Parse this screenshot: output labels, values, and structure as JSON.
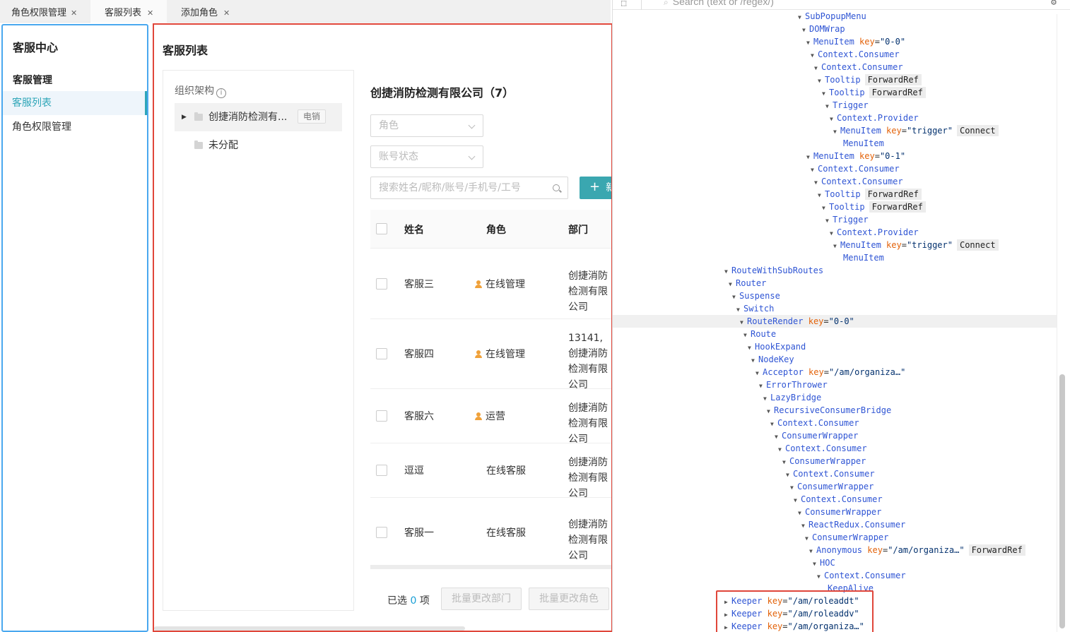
{
  "tabs": [
    {
      "label": "角色权限管理",
      "active": false
    },
    {
      "label": "客服列表",
      "active": true
    },
    {
      "label": "添加角色",
      "active": false
    }
  ],
  "sidebar": {
    "title": "客服中心",
    "section": "客服管理",
    "items": [
      {
        "label": "客服列表",
        "active": true
      },
      {
        "label": "角色权限管理",
        "active": false
      }
    ]
  },
  "main": {
    "title": "客服列表",
    "org": {
      "header": "组织架构",
      "nodes": [
        {
          "label": "创捷消防检测有...",
          "tag": "电销"
        },
        {
          "label": "未分配"
        }
      ]
    },
    "company": "创捷消防检测有限公司（7）",
    "filters": {
      "role_placeholder": "角色",
      "status_placeholder": "账号状态"
    },
    "search_placeholder": "搜索姓名/昵称/账号/手机号/工号",
    "add_label": "新",
    "table": {
      "columns": [
        "姓名",
        "角色",
        "部门"
      ],
      "rows": [
        {
          "name": "客服三",
          "role": "在线管理",
          "dept": "创捷消防检测有限公司",
          "admin": true
        },
        {
          "name": "客服四",
          "role": "在线管理",
          "dept": "13141,创捷消防检测有限公司",
          "admin": true
        },
        {
          "name": "客服六",
          "role": "运营",
          "dept": "创捷消防检测有限公司",
          "admin": true
        },
        {
          "name": "逗逗",
          "role": "在线客服",
          "dept": "创捷消防检测有限公司",
          "admin": false
        },
        {
          "name": "客服一",
          "role": "在线客服",
          "dept": "创捷消防检测有限公司",
          "admin": false
        }
      ]
    },
    "footer": {
      "selected_prefix": "已选",
      "selected_count": "0",
      "selected_suffix": "项",
      "btn_dept": "批量更改部门",
      "btn_role": "批量更改角色"
    }
  },
  "devtools": {
    "search_placeholder": "Search (text or /regex/)",
    "tree": [
      {
        "indent": 262,
        "name": "SubPopupMenu"
      },
      {
        "indent": 268,
        "name": "DOMWrap"
      },
      {
        "indent": 274,
        "name": "MenuItem",
        "key": "0-0"
      },
      {
        "indent": 280,
        "name": "Context.Consumer"
      },
      {
        "indent": 285,
        "name": "Context.Consumer"
      },
      {
        "indent": 290,
        "name": "Tooltip",
        "badge": "ForwardRef"
      },
      {
        "indent": 296,
        "name": "Tooltip",
        "badge": "ForwardRef"
      },
      {
        "indent": 301,
        "name": "Trigger"
      },
      {
        "indent": 307,
        "name": "Context.Provider"
      },
      {
        "indent": 312,
        "name": "MenuItem",
        "key": "trigger",
        "badge": "Connect"
      },
      {
        "indent": 326,
        "name": "MenuItem",
        "leaf": true
      },
      {
        "indent": 274,
        "name": "MenuItem",
        "key": "0-1"
      },
      {
        "indent": 280,
        "name": "Context.Consumer"
      },
      {
        "indent": 285,
        "name": "Context.Consumer"
      },
      {
        "indent": 290,
        "name": "Tooltip",
        "badge": "ForwardRef"
      },
      {
        "indent": 296,
        "name": "Tooltip",
        "badge": "ForwardRef"
      },
      {
        "indent": 301,
        "name": "Trigger"
      },
      {
        "indent": 307,
        "name": "Context.Provider"
      },
      {
        "indent": 312,
        "name": "MenuItem",
        "key": "trigger",
        "badge": "Connect"
      },
      {
        "indent": 326,
        "name": "MenuItem",
        "leaf": true
      },
      {
        "indent": 158,
        "name": "RouteWithSubRoutes"
      },
      {
        "indent": 164,
        "name": "Router"
      },
      {
        "indent": 169,
        "name": "Suspense"
      },
      {
        "indent": 175,
        "name": "Switch"
      },
      {
        "indent": 180,
        "name": "RouteRender",
        "key": "0-0",
        "hl": true
      },
      {
        "indent": 185,
        "name": "Route"
      },
      {
        "indent": 191,
        "name": "HookExpand"
      },
      {
        "indent": 196,
        "name": "NodeKey"
      },
      {
        "indent": 202,
        "name": "Acceptor",
        "key": "/am/organiza…"
      },
      {
        "indent": 207,
        "name": "ErrorThrower"
      },
      {
        "indent": 213,
        "name": "LazyBridge"
      },
      {
        "indent": 218,
        "name": "RecursiveConsumerBridge"
      },
      {
        "indent": 223,
        "name": "Context.Consumer"
      },
      {
        "indent": 229,
        "name": "ConsumerWrapper"
      },
      {
        "indent": 234,
        "name": "Context.Consumer"
      },
      {
        "indent": 240,
        "name": "ConsumerWrapper"
      },
      {
        "indent": 245,
        "name": "Context.Consumer"
      },
      {
        "indent": 251,
        "name": "ConsumerWrapper"
      },
      {
        "indent": 256,
        "name": "Context.Consumer"
      },
      {
        "indent": 262,
        "name": "ConsumerWrapper"
      },
      {
        "indent": 267,
        "name": "ReactRedux.Consumer"
      },
      {
        "indent": 272,
        "name": "ConsumerWrapper"
      },
      {
        "indent": 278,
        "name": "Anonymous",
        "key": "/am/organiza…",
        "badge": "ForwardRef"
      },
      {
        "indent": 283,
        "name": "HOC"
      },
      {
        "indent": 289,
        "name": "Context.Consumer"
      },
      {
        "indent": 304,
        "name": "KeepAlive",
        "leaf": true
      },
      {
        "indent": 158,
        "name": "Keeper",
        "key": "/am/roleaddt",
        "collapsed": true
      },
      {
        "indent": 158,
        "name": "Keeper",
        "key": "/am/roleaddv",
        "collapsed": true
      },
      {
        "indent": 158,
        "name": "Keeper",
        "key": "/am/organiza…",
        "collapsed": true
      }
    ]
  }
}
